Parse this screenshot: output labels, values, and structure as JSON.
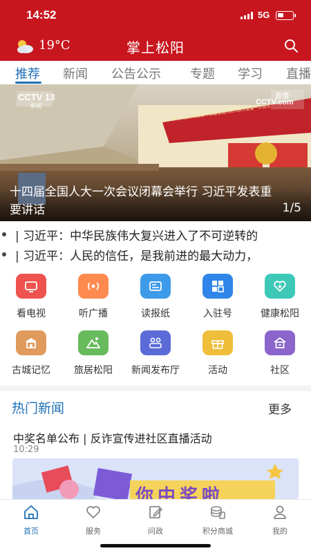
{
  "status_bar": {
    "time": "14:52",
    "network": "5G"
  },
  "header": {
    "temperature": "19°C",
    "title": "掌上松阳",
    "weather_icon": "cloudy-sun-icon",
    "search_icon": "search-icon"
  },
  "tabs": [
    {
      "label": "推荐",
      "active": true
    },
    {
      "label": "新闻"
    },
    {
      "label": "公告公示"
    },
    {
      "label": "专题"
    },
    {
      "label": "学习"
    },
    {
      "label": "直播"
    }
  ],
  "banner": {
    "caption": "十四届全国人大一次会议闭幕会举行 习近平发表重要讲话",
    "counter": "1/5",
    "channel_logo": "CCTV 13",
    "channel_sub": "新闻",
    "live_badge": "直播",
    "live_site": "CCTV.com",
    "stage_banner": "中华人民共和国第十四届全国人民代表大会第一次会议"
  },
  "ticker": [
    {
      "text": "| 习近平：中华民族伟大复兴进入了不可逆转的"
    },
    {
      "text": "| 习近平：人民的信任，是我前进的最大动力，"
    }
  ],
  "grid": [
    {
      "label": "看电视",
      "icon": "tv-icon",
      "color": "#ef5350"
    },
    {
      "label": "听广播",
      "icon": "radio-icon",
      "color": "#ff8a50"
    },
    {
      "label": "读报纸",
      "icon": "newspaper-icon",
      "color": "#3e9be9"
    },
    {
      "label": "入驻号",
      "icon": "apps-icon",
      "color": "#2f86e8"
    },
    {
      "label": "健康松阳",
      "icon": "health-icon",
      "color": "#3ec8b8"
    },
    {
      "label": "古城记忆",
      "icon": "ancient-city-icon",
      "color": "#e09a5c"
    },
    {
      "label": "旅居松阳",
      "icon": "mountain-icon",
      "color": "#67bb5d"
    },
    {
      "label": "新闻发布厅",
      "icon": "press-room-icon",
      "color": "#5a6bd8"
    },
    {
      "label": "活动",
      "icon": "gift-icon",
      "color": "#efbe3a"
    },
    {
      "label": "社区",
      "icon": "community-icon",
      "color": "#8b64cc"
    }
  ],
  "hot_news": {
    "title": "热门新闻",
    "more": "更多",
    "items": [
      {
        "title": "中奖名单公布 | 反诈宣传进社区直播活动",
        "time": "10:29",
        "image_text": "你中奖啦"
      }
    ]
  },
  "tabbar": [
    {
      "label": "首页",
      "icon": "home-icon",
      "active": true
    },
    {
      "label": "服务",
      "icon": "heart-icon"
    },
    {
      "label": "问政",
      "icon": "edit-icon"
    },
    {
      "label": "积分商城",
      "icon": "coins-icon"
    },
    {
      "label": "我的",
      "icon": "user-icon"
    }
  ],
  "colors": {
    "brand_red": "#c8161e",
    "accent_blue": "#1f6fb5"
  }
}
